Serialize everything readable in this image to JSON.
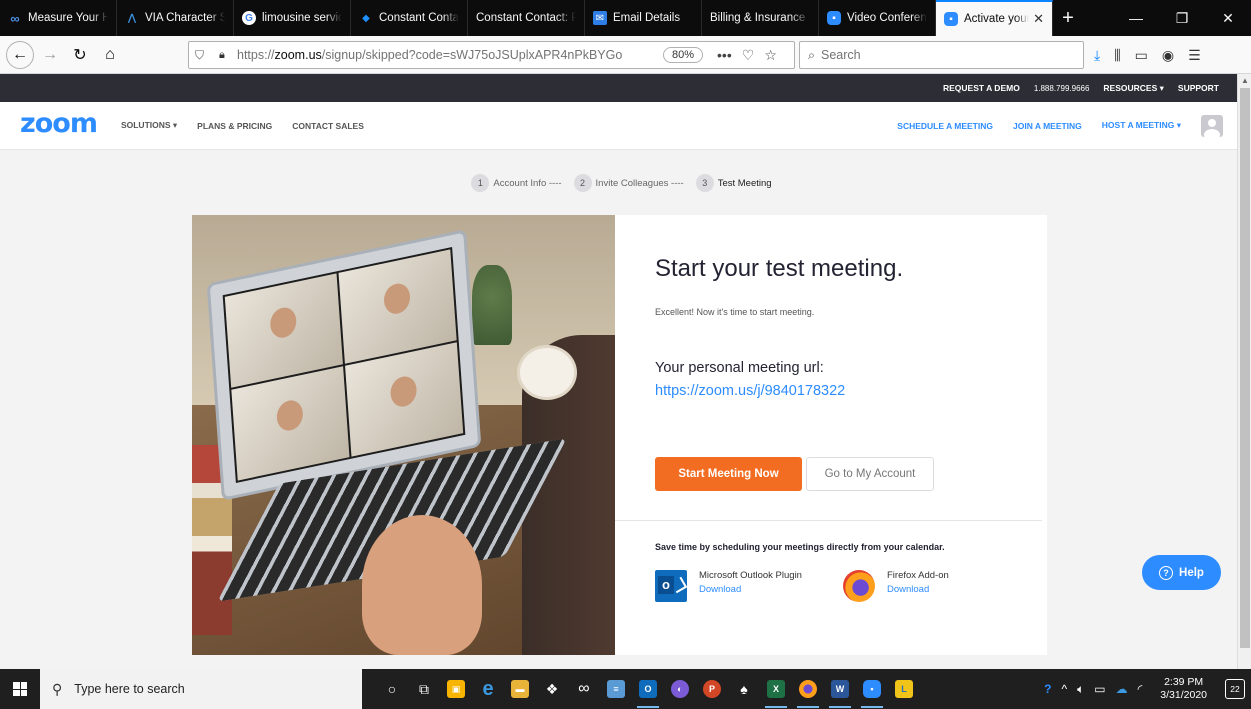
{
  "browser": {
    "tabs": [
      {
        "label": "Measure Your H",
        "icon": "infinity-icon",
        "color": "#1877f2"
      },
      {
        "label": "VIA Character St",
        "icon": "via-icon",
        "color": "#3b8edb"
      },
      {
        "label": "limousine servic",
        "icon": "google-icon",
        "color": "#ffffff"
      },
      {
        "label": "Constant Conta",
        "icon": "constant-contact-icon",
        "color": "#1856ed"
      },
      {
        "label": "Constant Contact: P",
        "icon": "",
        "color": ""
      },
      {
        "label": "Email Details",
        "icon": "email-icon",
        "color": "#2f7ee8"
      },
      {
        "label": "Billing & Insurance",
        "icon": "",
        "color": ""
      },
      {
        "label": "Video Conferen",
        "icon": "zoom-icon",
        "color": "#2d8cff"
      },
      {
        "label": "Activate your",
        "icon": "zoom-icon",
        "color": "#2d8cff"
      }
    ],
    "new_tab": "+",
    "url_prefix": "https://",
    "url_host": "zoom.us",
    "url_rest": "/signup/skipped?code=sWJ75oJSUplxAPR4nPkBYGo",
    "zoom_level": "80%",
    "search_placeholder": "Search"
  },
  "site": {
    "topbar": {
      "request_demo": "REQUEST A DEMO",
      "phone": "1.888.799.9666",
      "resources": "RESOURCES ▾",
      "support": "SUPPORT"
    },
    "logo": "zoom",
    "nav_left": [
      "SOLUTIONS ▾",
      "PLANS & PRICING",
      "CONTACT SALES"
    ],
    "nav_right": [
      "SCHEDULE A MEETING",
      "JOIN A MEETING",
      "HOST A MEETING ▾"
    ]
  },
  "steps": [
    {
      "num": "1",
      "label": "Account Info ----"
    },
    {
      "num": "2",
      "label": "Invite Colleagues ----"
    },
    {
      "num": "3",
      "label": "Test Meeting"
    }
  ],
  "main": {
    "title": "Start your test meeting.",
    "subtitle": "Excellent! Now it's time to start meeting.",
    "url_label": "Your personal meeting url:",
    "url_link": "https://zoom.us/j/9840178322",
    "start_button": "Start Meeting Now",
    "account_button": "Go to My Account",
    "calendar_text": "Save time by scheduling your meetings directly from your calendar.",
    "plugins": [
      {
        "name": "Microsoft Outlook Plugin",
        "link": "Download",
        "icon": "outlook-icon"
      },
      {
        "name": "Firefox Add-on",
        "link": "Download",
        "icon": "firefox-icon"
      }
    ],
    "help": "Help"
  },
  "taskbar": {
    "search_placeholder": "Type here to search",
    "time": "2:39 PM",
    "date": "3/31/2020",
    "notifications": "22"
  },
  "colors": {
    "accent": "#2d8cff",
    "start_button": "#f26d21"
  }
}
